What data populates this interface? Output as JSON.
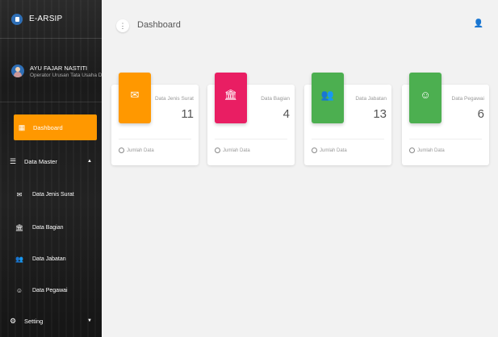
{
  "brand": {
    "name": "E-ARSIP"
  },
  "user": {
    "name": "AYU FAJAR NASTITI",
    "role": "Operator Urusan Tata Usaha Da"
  },
  "sidebar": {
    "dashboard": "Dashboard",
    "data_master": "Data Master",
    "sub_jenis": "Data Jenis Surat",
    "sub_bagian": "Data Bagian",
    "sub_jabatan": "Data Jabatan",
    "sub_pegawai": "Data Pegawai",
    "setting": "Setting"
  },
  "header": {
    "title": "Dashboard",
    "menu_glyph": "⋮",
    "user_glyph": "👤"
  },
  "cards": [
    {
      "label": "Data Jenis Surat",
      "value": "11",
      "footer": "Jumlah Data",
      "color": "#ff9800",
      "icon": "envelope-icon"
    },
    {
      "label": "Data Bagian",
      "value": "4",
      "footer": "Jumlah Data",
      "color": "#e91e63",
      "icon": "bank-icon"
    },
    {
      "label": "Data Jabatan",
      "value": "13",
      "footer": "Jumlah Data",
      "color": "#4caf50",
      "icon": "group-icon"
    },
    {
      "label": "Data Pegawai",
      "value": "6",
      "footer": "Jumlah Data",
      "color": "#4caf50",
      "icon": "face-icon"
    }
  ],
  "colors": {
    "accent": "#ff9800",
    "pink": "#e91e63",
    "green": "#4caf50",
    "sidebar": "#1e1e1e"
  }
}
